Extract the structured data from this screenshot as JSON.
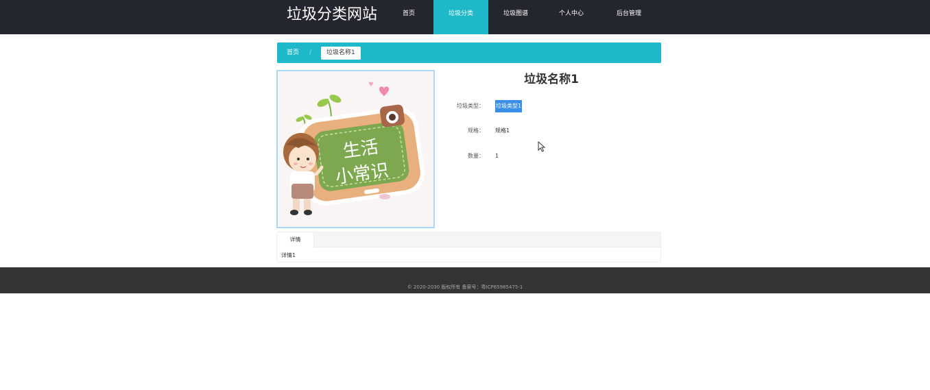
{
  "header": {
    "site_title": "垃圾分类网站",
    "nav": [
      {
        "label": "首页"
      },
      {
        "label": "垃圾分类"
      },
      {
        "label": "垃圾图谱"
      },
      {
        "label": "个人中心"
      },
      {
        "label": "后台管理"
      }
    ],
    "active_nav": "垃圾分类"
  },
  "breadcrumb": {
    "home": "首页",
    "separator": "/",
    "current": "垃圾名称1"
  },
  "detail": {
    "image_caption_line1": "生活",
    "image_caption_line2": "小常识",
    "title": "垃圾名称1",
    "fields": [
      {
        "label": "垃圾类型：",
        "value": "垃圾类型1"
      },
      {
        "label": "规格：",
        "value": "规格1"
      },
      {
        "label": "数量：",
        "value": "1"
      }
    ]
  },
  "tabs": {
    "items": [
      {
        "label": "详情"
      }
    ],
    "content": "详情1"
  },
  "footer": {
    "text": "© 2020-2030 版权所有 备案号：粤ICP65985475-1"
  },
  "colors": {
    "header_bg": "#23262e",
    "accent": "#1fb8c9",
    "selection": "#3a8ee6",
    "footer_bg": "#343434"
  }
}
